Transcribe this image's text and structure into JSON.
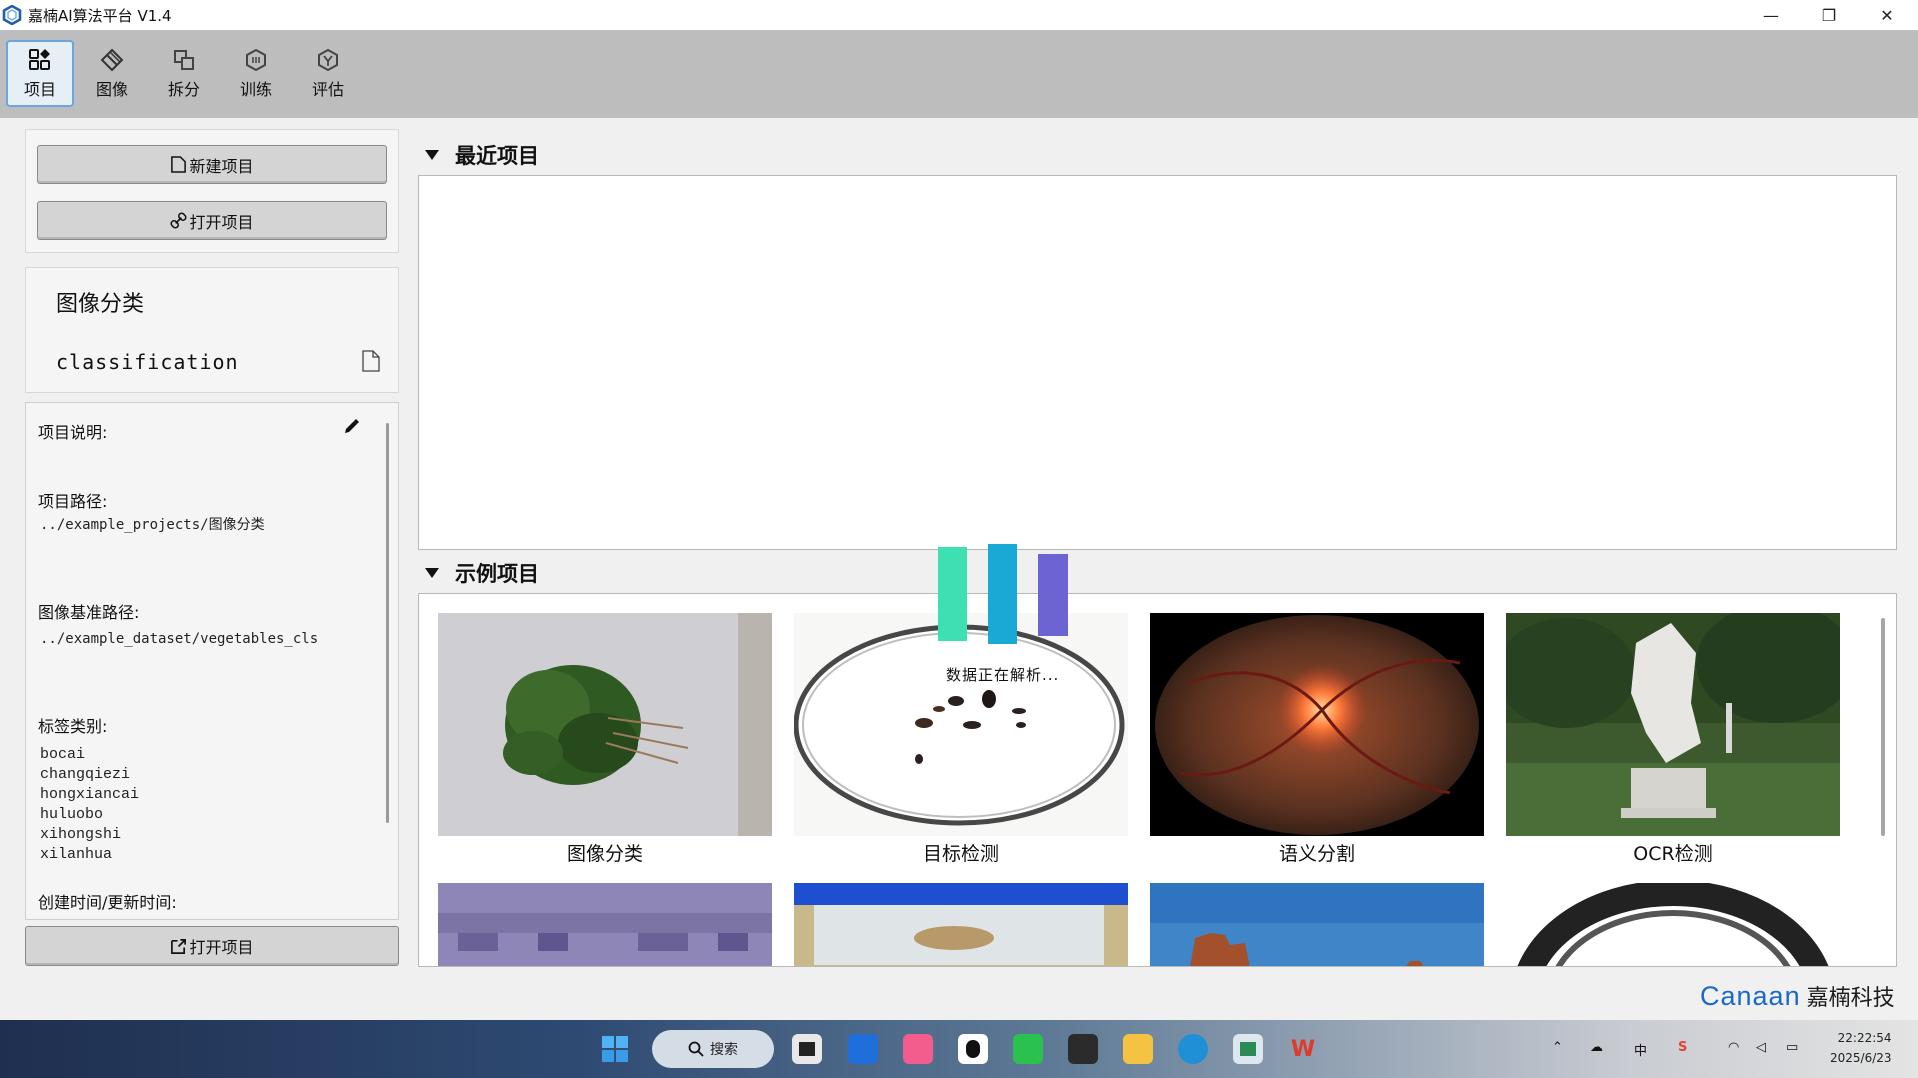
{
  "window": {
    "title": "嘉楠AI算法平台 V1.4",
    "minimize": "—",
    "restore": "❐",
    "close": "✕"
  },
  "toolbar": {
    "items": [
      {
        "label": "项目",
        "icon": "grid-icon"
      },
      {
        "label": "图像",
        "icon": "diamond-icon"
      },
      {
        "label": "拆分",
        "icon": "split-icon"
      },
      {
        "label": "训练",
        "icon": "hexagon-icon"
      },
      {
        "label": "评估",
        "icon": "badge-icon"
      }
    ]
  },
  "left": {
    "new_project": "新建项目",
    "open_project": "打开项目",
    "project_type": "图像分类",
    "project_name": "classification",
    "details": {
      "description_label": "项目说明:",
      "path_label": "项目路径:",
      "path_value": "../example_projects/图像分类",
      "image_base_label": "图像基准路径:",
      "image_base_value": "../example_dataset/vegetables_cls",
      "labels_label": "标签类别:",
      "labels": [
        "bocai",
        "changqiezi",
        "hongxiancai",
        "huluobo",
        "xihongshi",
        "xilanhua"
      ],
      "time_label": "创建时间/更新时间:"
    },
    "open_button": "打开项目"
  },
  "recent": {
    "title": "最近项目"
  },
  "examples": {
    "title": "示例项目",
    "items": [
      "图像分类",
      "目标检测",
      "语义分割",
      "OCR检测"
    ]
  },
  "loading_text": "数据正在解析...",
  "brand": {
    "en": "Canaan",
    "cn": "嘉楠科技"
  },
  "taskbar": {
    "search": "搜索",
    "ime": "中",
    "time": "22:22:54",
    "date": "2025/6/23"
  }
}
